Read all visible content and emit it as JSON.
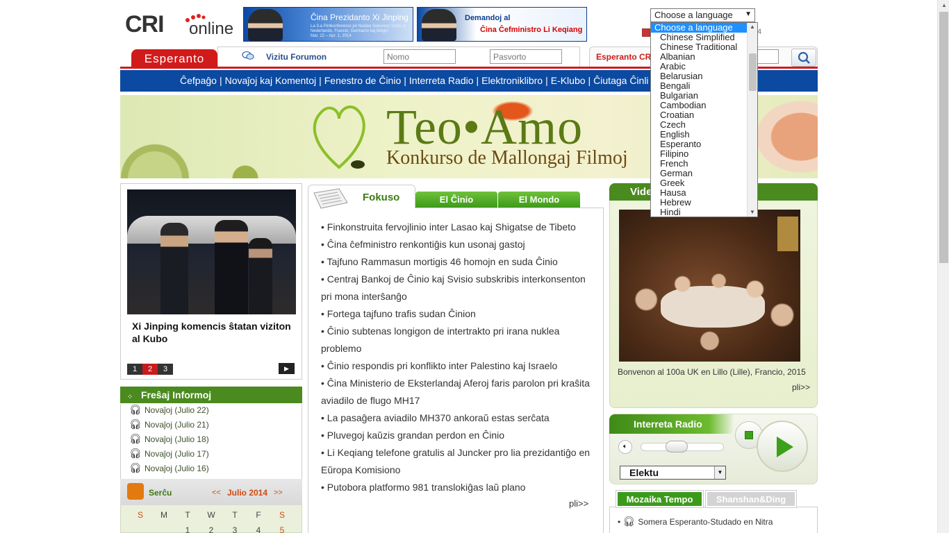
{
  "logo": {
    "text_cri": "CRI",
    "text_online": "online"
  },
  "banners": [
    {
      "title": "Ĉina Prezidanto Xi Jinping",
      "details": "La 3-a Pintkonferenco pri Nuklea Sekureco Vizito al Nederlando, Francio, Germanio kaj Belgio",
      "dates": "Mar. 22 – Apr. 1, 2014"
    },
    {
      "title": "Demandoj al",
      "subtitle": "Ĉina Ĉefministro Li Keqiang"
    }
  ],
  "language_select": {
    "value": "Choose a language",
    "options": [
      "Choose a language",
      "Chinese Simplified",
      "Chinese Traditional",
      "Albanian",
      "Arabic",
      "Belarusian",
      "Bengali",
      "Bulgarian",
      "Cambodian",
      "Croatian",
      "Czech",
      "English",
      "Esperanto",
      "Filipino",
      "French",
      "German",
      "Greek",
      "Hausa",
      "Hebrew",
      "Hindi"
    ],
    "selected_index": 0
  },
  "header": {
    "site_tab": "Esperanto",
    "forum_link": "Vizitu Forumon",
    "name_placeholder": "Nomo",
    "password_placeholder": "Pasvorto",
    "search_label": "Esperanto CR",
    "date_digit": "4"
  },
  "nav": {
    "items": [
      "Ĉefpaĝo",
      "Novaĵoj kaj Komentoj",
      "Fenestro de Ĉinio",
      "Interreta Radio",
      "Elektroniklibro",
      "E-Klubo",
      "Ĉiutaga Ĉinli"
    ],
    "separator": "|"
  },
  "hero": {
    "title": "Teo•Amo",
    "subtitle": "Konkurso de Mallongaj Filmoj"
  },
  "slideshow": {
    "caption": "Xi Jinping komencis ŝtatan viziton al Kubo",
    "pages": [
      "1",
      "2",
      "3"
    ],
    "active_page": 2,
    "next_icon": "play-next-icon"
  },
  "fresh": {
    "title": "Freŝaj Informoj",
    "items": [
      "Novaĵoj (Julio 22)",
      "Novaĵoj (Julio 21)",
      "Novaĵoj (Julio 18)",
      "Novaĵoj (Julio 17)",
      "Novaĵoj (Julio 16)"
    ]
  },
  "calendar": {
    "label": "Serĉu",
    "prev": "<<",
    "month": "Julio 2014",
    "next": ">>",
    "weekdays": [
      "S",
      "M",
      "T",
      "W",
      "T",
      "F",
      "S"
    ],
    "first_row": [
      "",
      "",
      "1",
      "2",
      "3",
      "4",
      "5"
    ]
  },
  "center": {
    "tabs": {
      "focus": "Fokuso",
      "china": "El Ĉinio",
      "world": "El Mondo"
    },
    "news": [
      "Finkonstruita fervojlinio inter Lasao kaj Shigatse de Tibeto",
      "Ĉina ĉefministro renkontiĝis kun usonaj gastoj",
      "Tajfuno Rammasun mortigis 46 homojn en suda Ĉinio",
      "Centraj Bankoj de Ĉinio kaj Svisio subskribis interkonsenton pri mona interŝanĝo",
      "Fortega tajfuno trafis sudan Ĉinion",
      "Ĉinio subtenas longigon de intertrakto pri irana nuklea problemo",
      "Ĉinio respondis pri konflikto inter Palestino kaj Israelo",
      "Ĉina Ministerio de Eksterlandaj Aferoj faris parolon pri kraŝita aviadilo de flugo MH17",
      "La pasaĝera aviadilo MH370 ankoraŭ estas serĉata",
      "Pluvegoj kaŭzis grandan perdon en Ĉinio",
      "Li Keqiang telefone gratulis al Juncker pro lia prezidantiĝo en Eŭropa Komisiono",
      "Putobora platformo 981 translokiĝas laŭ plano"
    ],
    "bullet": "•",
    "more": "pli>>"
  },
  "video": {
    "title": "Vide",
    "caption": "Bonvenon al 100a UK en Lillo (Lille), Francio, 2015",
    "more": "pli>>"
  },
  "radio": {
    "title": "Interreta Radio",
    "channel": "Elektu"
  },
  "mozaika": {
    "tabs": [
      "Mozaika Tempo",
      "Shanshan&Ding"
    ],
    "items": [
      "Somera Esperanto-Studado en Nitra"
    ]
  },
  "colors": {
    "brand_red": "#d11b1b",
    "nav_blue": "#0b4aa0",
    "green": "#4a8a1f"
  }
}
